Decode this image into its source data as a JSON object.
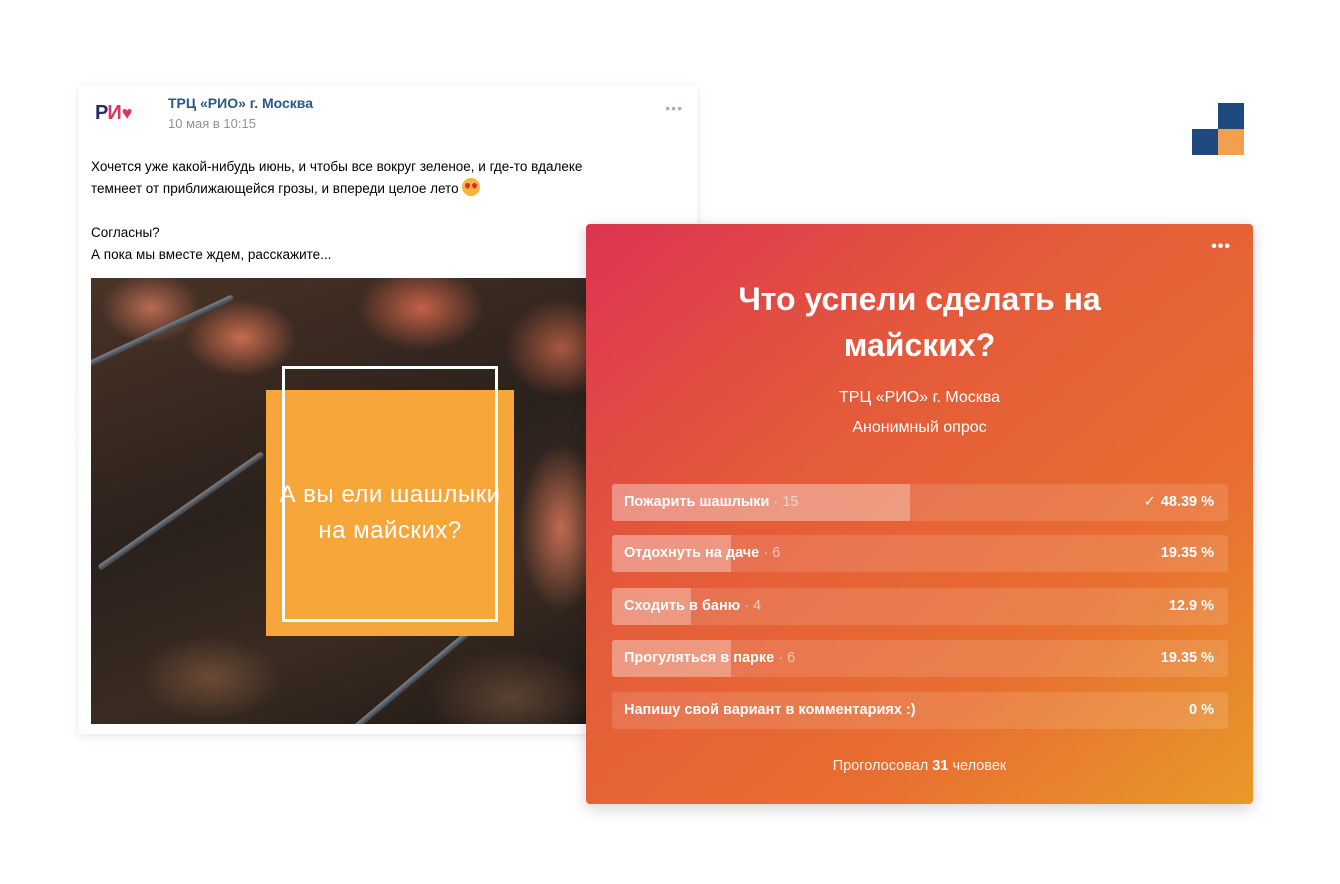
{
  "post": {
    "community_name": "ТРЦ «РИО» г. Москва",
    "date": "10 мая в 10:15",
    "more": "•••",
    "logo": {
      "text_a": "Р",
      "text_b": "И",
      "heart": "♥"
    },
    "text_line1": "Хочется уже какой-нибудь июнь, и чтобы все вокруг зеленое, и где-то вдалеке",
    "text_line2": "темнеет от приближающейся грозы, и впереди целое лето",
    "emoji": "smiling-face-with-heart-eyes",
    "text_line3": "Согласны?",
    "text_line4": "А пока мы вместе ждем, расскажите...",
    "photo_caption": "А вы ели шашлыки на майских?"
  },
  "poll": {
    "more": "•••",
    "title_line1": "Что успели сделать на",
    "title_line2": "майских?",
    "author": "ТРЦ «РИО» г. Москва",
    "type": "Анонимный опрос",
    "options": [
      {
        "label": "Пожарить шашлыки",
        "count": "· 15",
        "percent": "48.39 %",
        "fraction": 0.4839,
        "voted": true
      },
      {
        "label": "Отдохнуть на даче",
        "count": "· 6",
        "percent": "19.35 %",
        "fraction": 0.1935,
        "voted": false
      },
      {
        "label": "Сходить в баню",
        "count": "· 4",
        "percent": "12.9 %",
        "fraction": 0.129,
        "voted": false
      },
      {
        "label": "Прогуляться в парке",
        "count": "· 6",
        "percent": "19.35 %",
        "fraction": 0.1935,
        "voted": false
      },
      {
        "label": "Напишу свой вариант в комментариях :)",
        "count": "",
        "percent": "0 %",
        "fraction": 0,
        "voted": false
      }
    ],
    "voters_prefix": "Проголосовал",
    "voters_count": "31",
    "voters_suffix": "человек"
  },
  "colors": {
    "brand_dark_blue": "#1e4a80",
    "brand_orange": "#f0a050",
    "poll_gradient_start": "#dd3452",
    "poll_gradient_end": "#e8992a",
    "photo_overlay": "#f7a63a"
  }
}
